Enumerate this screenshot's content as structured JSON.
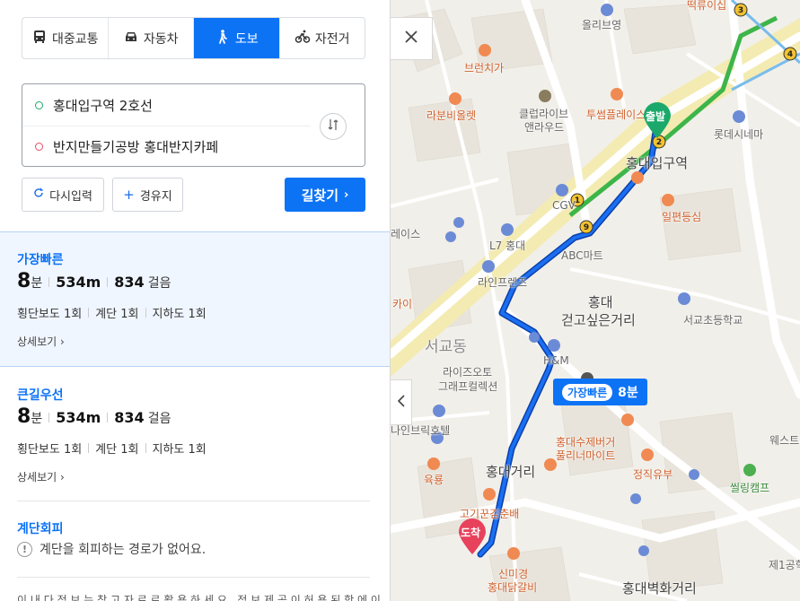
{
  "modes": [
    {
      "label": "대중교통",
      "icon": "bus-icon",
      "active": false
    },
    {
      "label": "자동차",
      "icon": "car-icon",
      "active": false
    },
    {
      "label": "도보",
      "icon": "walk-icon",
      "active": true
    },
    {
      "label": "자전거",
      "icon": "bicycle-icon",
      "active": false
    }
  ],
  "search": {
    "start": "홍대입구역 2호선",
    "end": "반지만들기공방 홍대반지카페"
  },
  "buttons": {
    "reset": "다시입력",
    "via": "경유지",
    "find": "길찾기"
  },
  "routes": [
    {
      "title": "가장빠른",
      "minutes": "8",
      "min_unit": "분",
      "distance": "534m",
      "steps": "834",
      "steps_unit": "걸음",
      "details": [
        "횡단보도 1회",
        "계단 1회",
        "지하도 1회"
      ],
      "more": "상세보기"
    },
    {
      "title": "큰길우선",
      "minutes": "8",
      "min_unit": "분",
      "distance": "534m",
      "steps": "834",
      "steps_unit": "걸음",
      "details": [
        "횡단보도 1회",
        "계단 1회",
        "지하도 1회"
      ],
      "more": "상세보기"
    }
  ],
  "stairs": {
    "title": "계단회피",
    "message": "계단을 회피하는 경로가 없어요."
  },
  "note": "이 내 다 정 보 는 참 고 자 료 로 활 용 하 세 요 . 정 보 제 공 이 허 용 된 항 에 이",
  "map": {
    "route_tag": {
      "label": "가장빠른",
      "time": "8분"
    },
    "start_marker": "출발",
    "end_marker": "도착",
    "labels": {
      "station_olive": "올리브영",
      "ttok": "떡류이십",
      "brunch": "브런치가",
      "lafun": "라분비올렛",
      "club": "클럽라이브",
      "enlaud": "앤라우드",
      "twosome": "투썸플레이스",
      "hongik_station": "홍대입구역",
      "lotte_cinema": "롯데시네마",
      "cgv": "CGV",
      "ilmyeon": "일편등심",
      "lace": "레이스",
      "l7": "L7 홍대",
      "abc": "ABC마트",
      "lineprince": "라인프렌즈",
      "kai": "카이",
      "hongdae": "홍대",
      "walkstreet": "걷고싶은거리",
      "seogyo_school": "서교초등학교",
      "seogyodong": "서교동",
      "rises": "라이즈오토",
      "graphic": "그래프컬렉션",
      "hm": "H&M",
      "nine": "나인브릭호텔",
      "handmade": "홍대수제버거",
      "fuller": "풀리너마이트",
      "west": "웨스트",
      "hongdae_st": "홍대거리",
      "jeongjin": "정직유부",
      "ssiling": "씰링캠프",
      "yukryung": "육룡",
      "gogi": "고기꾼김춘배",
      "sinmigyeong": "신미경",
      "dalgalbi": "홍대닭갈비",
      "jeil": "제1공학",
      "wall": "홍대벽화거리"
    }
  }
}
